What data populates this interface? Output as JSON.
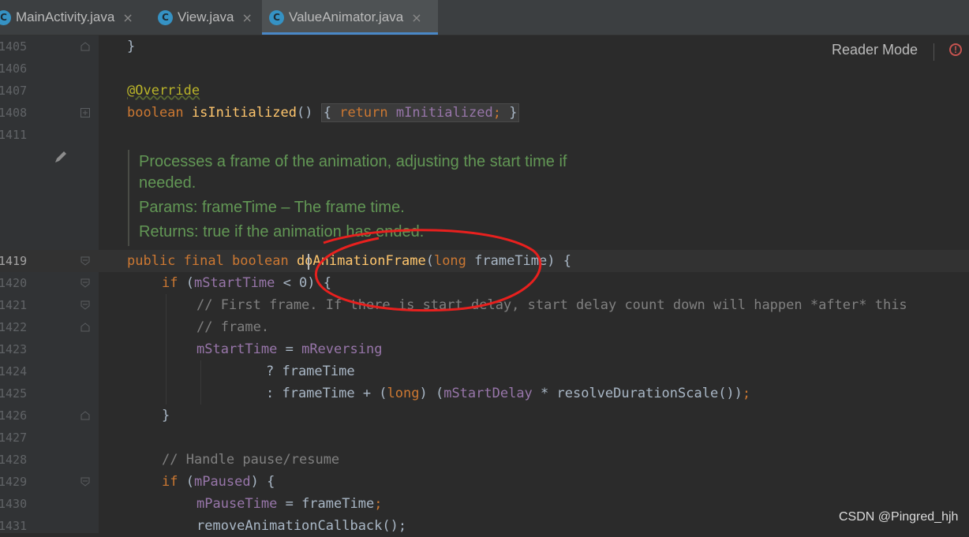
{
  "tabs": [
    {
      "icon": "C",
      "label": "MainActivity.java",
      "close": "×",
      "active": false
    },
    {
      "icon": "C",
      "label": "View.java",
      "close": "×",
      "active": false
    },
    {
      "icon": "C",
      "label": "ValueAnimator.java",
      "close": "×",
      "active": true
    }
  ],
  "toolbar": {
    "reader_mode": "Reader Mode",
    "error_glyph": "!"
  },
  "line_numbers": [
    "1405",
    "1406",
    "1407",
    "1408",
    "1411",
    "1419",
    "1420",
    "1421",
    "1422",
    "1423",
    "1424",
    "1425",
    "1426",
    "1427",
    "1428",
    "1429",
    "1430",
    "1431"
  ],
  "code": {
    "l1405": "}",
    "l1407_ann": "@Override",
    "l1408_kw": "boolean",
    "l1408_fn": "isInitialized",
    "l1408_paren": "()",
    "l1408_open": "{",
    "l1408_ret": "return",
    "l1408_field": "mInitialized",
    "l1408_semi": ";",
    "l1408_close": "}",
    "l1419_mods": "public final boolean ",
    "l1419_fn": "doAnimationFrame",
    "l1419_open": "(",
    "l1419_type": "long",
    "l1419_rest": " frameTime) {",
    "l1420_if": "if",
    "l1420_rest_a": " (",
    "l1420_field": "mStartTime",
    "l1420_rest_b": " < 0) {",
    "l1421": "// First frame. If there is start delay, start delay count down will happen *after* this",
    "l1422": "// frame.",
    "l1423_field": "mStartTime",
    "l1423_eq": " = ",
    "l1423_field2": "mReversing",
    "l1424": "? frameTime",
    "l1425_a": ": frameTime + (",
    "l1425_long": "long",
    "l1425_b": ") (",
    "l1425_field": "mStartDelay",
    "l1425_c": " * resolveDurationScale())",
    "l1425_semi": ";",
    "l1426": "}",
    "l1428": "// Handle pause/resume",
    "l1429_if": "if",
    "l1429_a": " (",
    "l1429_field": "mPaused",
    "l1429_b": ") {",
    "l1430_field": "mPauseTime",
    "l1430_b": " = frameTime",
    "l1430_semi": ";",
    "l1431": "removeAnimationCallback();"
  },
  "doc": {
    "summary_1": "Processes a frame of the animation, adjusting the start time if",
    "summary_2": "needed.",
    "params": "Params: frameTime – The frame time.",
    "returns": "Returns: true if the animation has ended."
  },
  "watermark": "CSDN @Pingred_hjh",
  "colors": {
    "keyword": "#cc7832",
    "method": "#ffc66d",
    "field": "#9876aa",
    "comment": "#808080",
    "doc": "#629755",
    "annotation": "#bbb529",
    "annotation_highlight": "#ff2a2a"
  }
}
